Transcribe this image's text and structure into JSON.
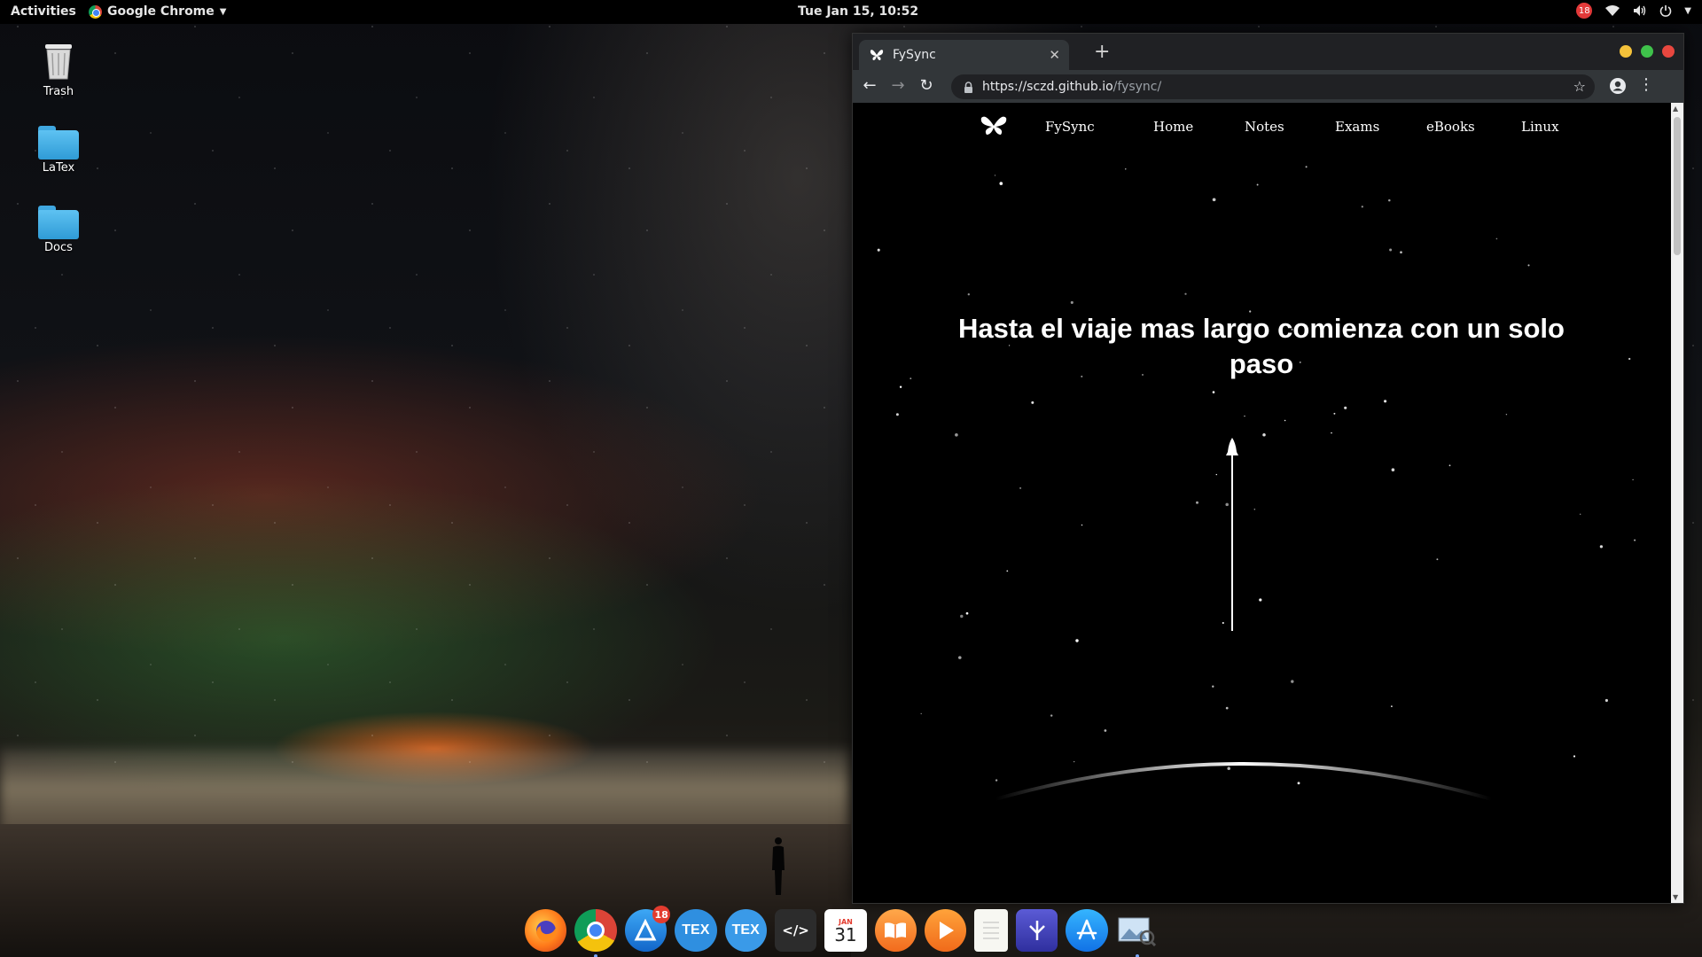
{
  "topbar": {
    "activities": "Activities",
    "app_name": "Google Chrome",
    "clock": "Tue Jan 15, 10:52",
    "notification_count": "18"
  },
  "desktop": {
    "icons": [
      {
        "label": "Trash"
      },
      {
        "label": "LaTex"
      },
      {
        "label": "Docs"
      }
    ]
  },
  "browser": {
    "tab_title": "FySync",
    "url_host": "https://sczd.github.io",
    "url_path": "/fysync/",
    "colors": {
      "frame": "#202124",
      "toolbar": "#323639",
      "close": "#e8473f",
      "minimize": "#f5c23a",
      "maximize": "#3fc24b"
    }
  },
  "site": {
    "brand": "FySync",
    "nav": [
      "Home",
      "Notes",
      "Exams",
      "eBooks",
      "Linux"
    ],
    "headline": "Hasta el viaje mas largo comienza con un solo paso"
  },
  "dock": {
    "apps": [
      {
        "name": "firefox-icon"
      },
      {
        "name": "chrome-icon"
      },
      {
        "name": "app-updater-icon",
        "badge": "18"
      },
      {
        "name": "texmaker-icon",
        "text": "TEX"
      },
      {
        "name": "texstudio-icon",
        "text": "TEX"
      },
      {
        "name": "code-editor-icon",
        "text": "</>"
      },
      {
        "name": "calendar-icon",
        "month": "JAN",
        "day": "31"
      },
      {
        "name": "books-icon"
      },
      {
        "name": "media-player-icon"
      },
      {
        "name": "notes-icon"
      },
      {
        "name": "mail-icon"
      },
      {
        "name": "app-store-icon"
      },
      {
        "name": "image-viewer-icon"
      }
    ]
  }
}
